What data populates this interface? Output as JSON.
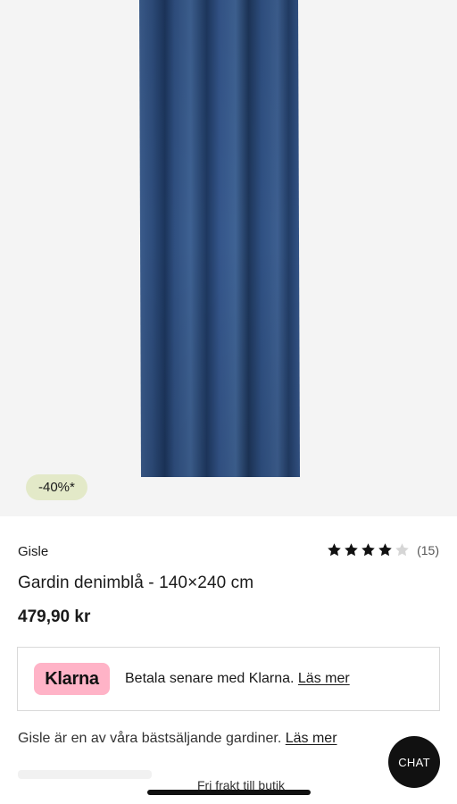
{
  "product": {
    "discount_badge": "-40%*",
    "brand": "Gisle",
    "title": "Gardin denimblå - 140×240 cm",
    "price": "479,90 kr",
    "rating": {
      "value": 4,
      "max": 5,
      "count_label": "(15)"
    },
    "image_icon": "curtain-photo"
  },
  "klarna": {
    "logo_text": "Klarna",
    "text": "Betala senare med Klarna.",
    "link": "Läs mer",
    "brand_color": "#ffb3c7"
  },
  "description": {
    "text": "Gisle är en av våra bästsäljande gardiner.",
    "link": "Läs mer"
  },
  "chat": {
    "label": "CHAT"
  },
  "footer": {
    "free_shipping": "Fri frakt till butik"
  },
  "colors": {
    "curtain": "#2f4f7f",
    "badge": "#e3e9c8",
    "star": "#111111",
    "star_empty": "#d6d6d6"
  }
}
